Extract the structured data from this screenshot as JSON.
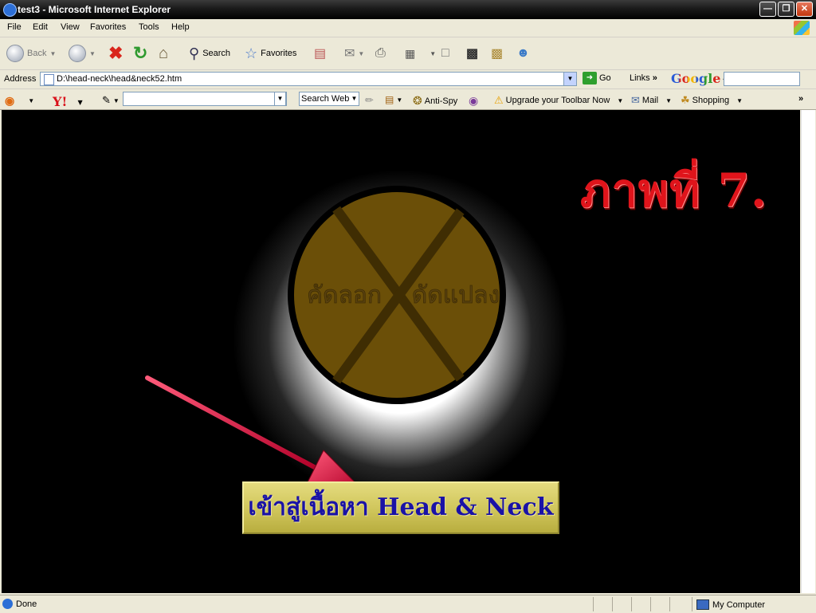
{
  "window": {
    "title": "test3 - Microsoft Internet Explorer"
  },
  "menu": [
    "File",
    "Edit",
    "View",
    "Favorites",
    "Tools",
    "Help"
  ],
  "toolbar": {
    "back": "Back",
    "search": "Search",
    "favorites": "Favorites"
  },
  "address": {
    "label": "Address",
    "url": "D:\\head-neck\\head&neck52.htm",
    "go": "Go",
    "links": "Links",
    "google": "Google"
  },
  "yahoo_bar": {
    "search_web": "Search Web",
    "anti_spy": "Anti-Spy",
    "upgrade": "Upgrade your Toolbar Now",
    "mail": "Mail",
    "shopping": "Shopping"
  },
  "page": {
    "heading": "ภาพที่ 7.",
    "disc_left": "คัดลอก",
    "disc_right": "ดัดแปลง",
    "enter_button": "เข้าสู่เนื้อหา Head & Neck",
    "colors": {
      "background": "#000000",
      "disc": "#6b4f08",
      "heading": "#e0141b",
      "button": "#d6cc62",
      "button_text": "#1a12a6",
      "arrow": "#d0103c"
    }
  },
  "status": {
    "left": "Done",
    "right": "My Computer"
  }
}
